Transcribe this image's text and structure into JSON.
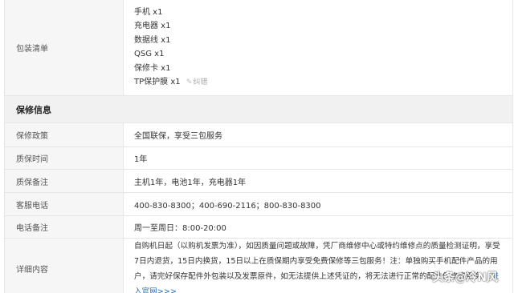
{
  "package": {
    "label": "包装清单",
    "items": [
      "手机 x1",
      "充电器 x1",
      "数据线 x1",
      "QSG x1",
      "保修卡 x1",
      "TP保护膜 x1"
    ],
    "edit_label": "纠错"
  },
  "warranty": {
    "title": "保修信息",
    "rows": [
      {
        "key": "保修政策",
        "value": "全国联保，享受三包服务"
      },
      {
        "key": "质保时间",
        "value": "1年"
      },
      {
        "key": "质保备注",
        "value": "主机1年，电池1年，充电器1年"
      },
      {
        "key": "客服电话",
        "value": "400-830-8300；400-690-2116；800-830-8300"
      },
      {
        "key": "电话备注",
        "value": "周一至周日：8:00-20:00"
      }
    ],
    "detail": {
      "key": "详细内容",
      "text": "自购机日起（以购机发票为准），如因质量问题或故障，凭厂商维修中心或特约维修点的质量检测证明，享受7日内退货，15日内换货，15日以上在质保期内享受免费保修等三包服务！注：单独购买手机配件产品的用户，请完好保存配件外包装以及发票原件，如无法提供上述凭证的，将无法进行正常的配件保修或更换。",
      "link": "进入官网>>>"
    }
  },
  "watermark": "头条@冷N风"
}
